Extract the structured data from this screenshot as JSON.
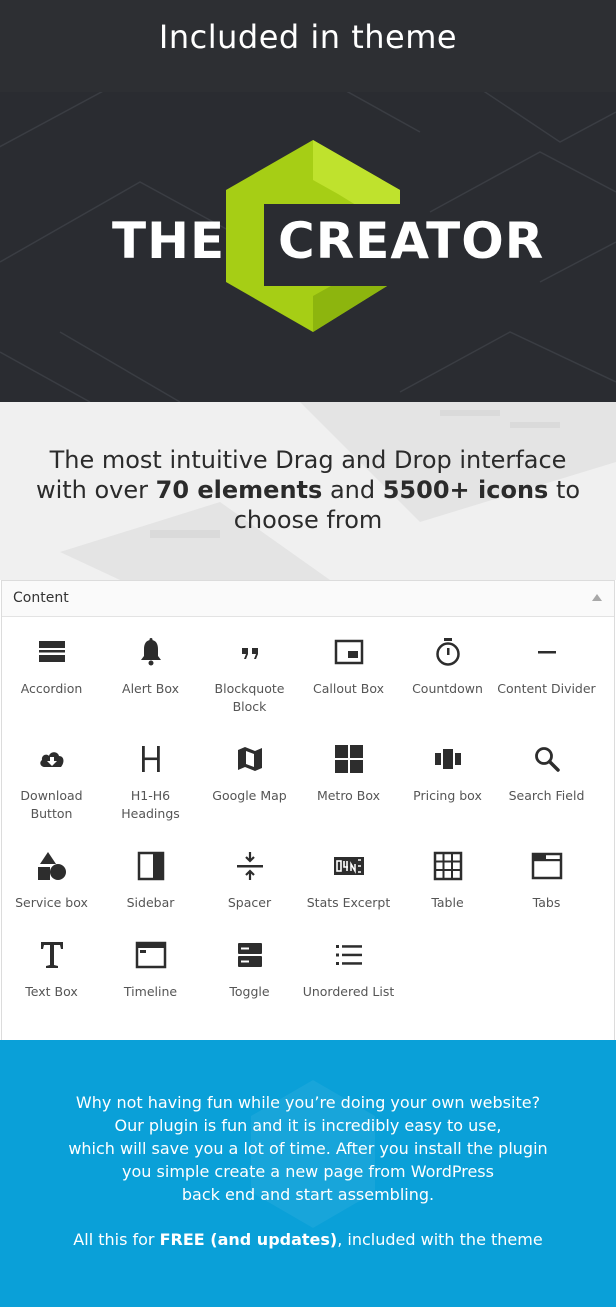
{
  "header": {
    "title": "Included in theme"
  },
  "logo": {
    "word1": "THE",
    "word2": "CREATOR",
    "accent_color": "#a6ce15"
  },
  "tagline": {
    "line1": "The most intuitive Drag and Drop interface",
    "line2_pre": "with over ",
    "line2_bold1": "70 elements",
    "line2_mid": " and ",
    "line2_bold2": "5500+ icons",
    "line2_post": " to",
    "line3": "choose from"
  },
  "panel": {
    "title": "Content",
    "elements": [
      {
        "label": "Accordion",
        "icon": "accordion-icon"
      },
      {
        "label": "Alert Box",
        "icon": "bell-icon"
      },
      {
        "label": "Blockquote Block",
        "icon": "quote-icon"
      },
      {
        "label": "Callout Box",
        "icon": "callout-icon"
      },
      {
        "label": "Countdown",
        "icon": "stopwatch-icon"
      },
      {
        "label": "Content Divider",
        "icon": "divider-icon"
      },
      {
        "label": "Download Button",
        "icon": "cloud-download-icon"
      },
      {
        "label": "H1-H6 Headings",
        "icon": "heading-icon"
      },
      {
        "label": "Google Map",
        "icon": "map-icon"
      },
      {
        "label": "Metro Box",
        "icon": "grid-squares-icon"
      },
      {
        "label": "Pricing box",
        "icon": "pricing-icon"
      },
      {
        "label": "Search Field",
        "icon": "search-icon"
      },
      {
        "label": "Service box",
        "icon": "shapes-icon"
      },
      {
        "label": "Sidebar",
        "icon": "sidebar-icon"
      },
      {
        "label": "Spacer",
        "icon": "spacer-icon"
      },
      {
        "label": "Stats Excerpt",
        "icon": "stats-counter-icon"
      },
      {
        "label": "Table",
        "icon": "table-icon"
      },
      {
        "label": "Tabs",
        "icon": "tabs-icon"
      },
      {
        "label": "Text Box",
        "icon": "text-t-icon"
      },
      {
        "label": "Timeline",
        "icon": "timeline-icon"
      },
      {
        "label": "Toggle",
        "icon": "toggle-icon"
      },
      {
        "label": "Unordered List",
        "icon": "list-icon"
      }
    ]
  },
  "bottom": {
    "line1": "Why not having fun while you’re doing your own website?",
    "line2": "Our plugin is fun and it is incredibly easy to use,",
    "line3": "which will save you a lot of time. After you install the plugin",
    "line4": "you simple create a new page from WordPress",
    "line5": "back end and start assembling.",
    "free_pre": "All this for ",
    "free_bold": "FREE (and updates)",
    "free_post": ", included with the theme",
    "bg_color": "#0aa0d8"
  }
}
